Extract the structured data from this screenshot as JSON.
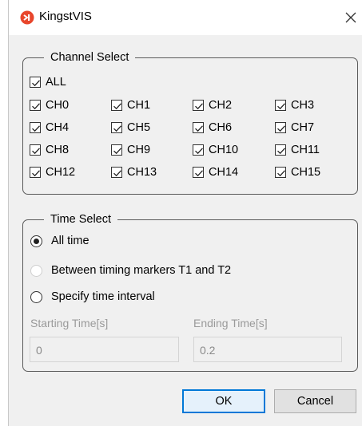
{
  "window": {
    "title": "KingstVIS",
    "brand_color": "#e8462c"
  },
  "channel_select": {
    "legend": "Channel Select",
    "all": {
      "label": "ALL",
      "checked": true
    },
    "channels": [
      {
        "label": "CH0",
        "checked": true
      },
      {
        "label": "CH1",
        "checked": true
      },
      {
        "label": "CH2",
        "checked": true
      },
      {
        "label": "CH3",
        "checked": true
      },
      {
        "label": "CH4",
        "checked": true
      },
      {
        "label": "CH5",
        "checked": true
      },
      {
        "label": "CH6",
        "checked": true
      },
      {
        "label": "CH7",
        "checked": true
      },
      {
        "label": "CH8",
        "checked": true
      },
      {
        "label": "CH9",
        "checked": true
      },
      {
        "label": "CH10",
        "checked": true
      },
      {
        "label": "CH11",
        "checked": true
      },
      {
        "label": "CH12",
        "checked": true
      },
      {
        "label": "CH13",
        "checked": true
      },
      {
        "label": "CH14",
        "checked": true
      },
      {
        "label": "CH15",
        "checked": true
      }
    ]
  },
  "time_select": {
    "legend": "Time Select",
    "options": [
      {
        "label": "All time",
        "selected": true,
        "enabled": true
      },
      {
        "label": "Between timing markers T1 and T2",
        "selected": false,
        "enabled": false
      },
      {
        "label": "Specify time interval",
        "selected": false,
        "enabled": true
      }
    ],
    "starting_label": "Starting Time[s]",
    "starting_value": "0",
    "ending_label": "Ending Time[s]",
    "ending_value": "0.2"
  },
  "buttons": {
    "ok": "OK",
    "cancel": "Cancel"
  },
  "icons": {
    "app": "kingstvis-logo-icon",
    "close": "close-icon"
  }
}
